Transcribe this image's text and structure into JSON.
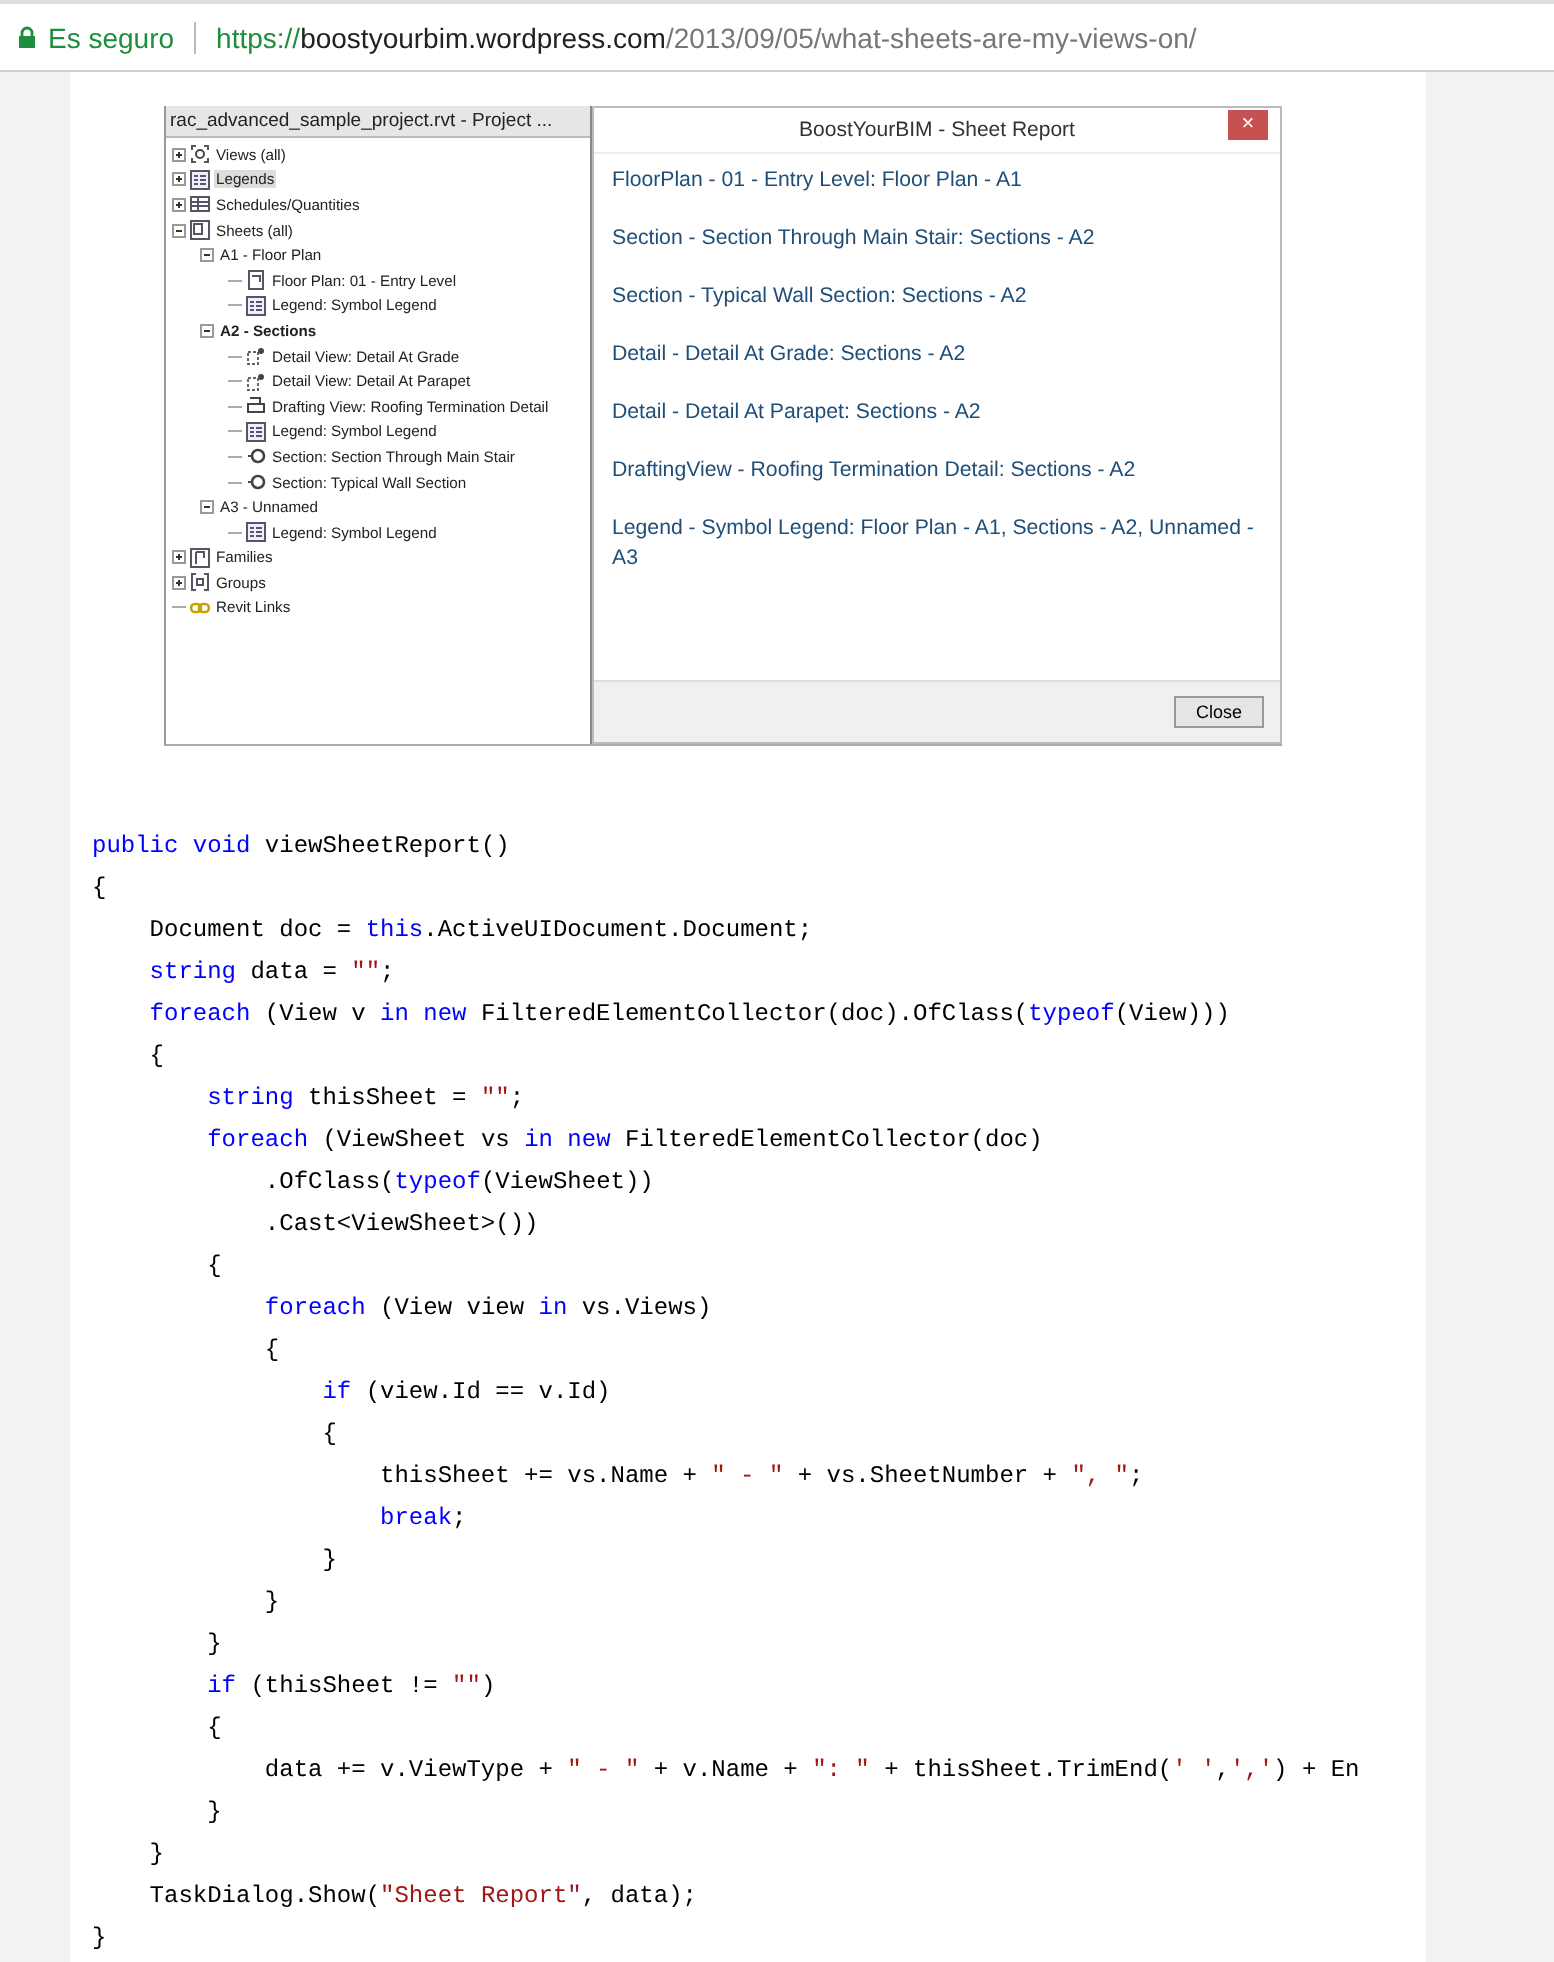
{
  "address_bar": {
    "security_label": "Es seguro",
    "url_scheme": "https://",
    "url_host": "boostyourbim.wordpress.com",
    "url_path": "/2013/09/05/what-sheets-are-my-views-on/"
  },
  "screenshot": {
    "project_browser": {
      "title": "rac_advanced_sample_project.rvt - Project ...",
      "tree": [
        {
          "label": "Views (all)",
          "kind": "views",
          "expanded": false,
          "selected": false,
          "bold": false
        },
        {
          "label": "Legends",
          "kind": "legend",
          "expanded": false,
          "selected": true,
          "bold": false
        },
        {
          "label": "Schedules/Quantities",
          "kind": "schedule",
          "expanded": false,
          "selected": false,
          "bold": false
        },
        {
          "label": "Sheets (all)",
          "kind": "sheet",
          "expanded": true,
          "selected": false,
          "bold": false,
          "children": [
            {
              "label": "A1 - Floor Plan",
              "expanded": true,
              "selected": false,
              "bold": false,
              "children": [
                {
                  "label": "Floor Plan: 01 - Entry Level",
                  "kind": "plan",
                  "selected": false,
                  "bold": false
                },
                {
                  "label": "Legend: Symbol Legend",
                  "kind": "legend",
                  "selected": false,
                  "bold": false
                }
              ]
            },
            {
              "label": "A2 - Sections",
              "expanded": true,
              "selected": false,
              "bold": true,
              "children": [
                {
                  "label": "Detail View: Detail At Grade",
                  "kind": "detail",
                  "selected": false,
                  "bold": false
                },
                {
                  "label": "Detail View: Detail At Parapet",
                  "kind": "detail",
                  "selected": false,
                  "bold": false
                },
                {
                  "label": "Drafting View: Roofing Termination Detail",
                  "kind": "drafting",
                  "selected": false,
                  "bold": false
                },
                {
                  "label": "Legend: Symbol Legend",
                  "kind": "legend",
                  "selected": false,
                  "bold": false
                },
                {
                  "label": "Section: Section Through Main Stair",
                  "kind": "section",
                  "selected": false,
                  "bold": false
                },
                {
                  "label": "Section: Typical Wall Section",
                  "kind": "section",
                  "selected": false,
                  "bold": false
                }
              ]
            },
            {
              "label": "A3 - Unnamed",
              "expanded": true,
              "selected": false,
              "bold": false,
              "children": [
                {
                  "label": "Legend: Symbol Legend",
                  "kind": "legend",
                  "selected": false,
                  "bold": false
                }
              ]
            }
          ]
        },
        {
          "label": "Families",
          "kind": "family",
          "expanded": false,
          "selected": false,
          "bold": false
        },
        {
          "label": "Groups",
          "kind": "group",
          "expanded": false,
          "selected": false,
          "bold": false
        },
        {
          "label": "Revit Links",
          "kind": "link",
          "selected": false,
          "bold": false
        }
      ]
    },
    "dialog": {
      "title": "BoostYourBIM - Sheet Report",
      "close_icon": "×",
      "lines": [
        "FloorPlan - 01 - Entry Level: Floor Plan - A1",
        "Section - Section Through Main Stair: Sections - A2",
        "Section - Typical Wall Section: Sections - A2",
        "Detail - Detail At Grade: Sections - A2",
        "Detail - Detail At Parapet: Sections - A2",
        "DraftingView - Roofing Termination Detail: Sections - A2",
        "Legend - Symbol Legend: Floor Plan - A1, Sections - A2, Unnamed - A3"
      ],
      "button": "Close"
    }
  },
  "code": [
    [
      {
        "kind": "keyword",
        "text": "public void"
      },
      {
        "kind": "plain",
        "text": " viewSheetReport()"
      }
    ],
    [
      {
        "kind": "plain",
        "text": "{"
      }
    ],
    [
      {
        "kind": "plain",
        "text": "    Document doc = "
      },
      {
        "kind": "keyword",
        "text": "this"
      },
      {
        "kind": "plain",
        "text": ".ActiveUIDocument.Document;"
      }
    ],
    [
      {
        "kind": "keyword",
        "text": "    string"
      },
      {
        "kind": "plain",
        "text": " data = "
      },
      {
        "kind": "string",
        "text": "\"\""
      },
      {
        "kind": "plain",
        "text": ";"
      }
    ],
    [
      {
        "kind": "keyword",
        "text": "    foreach"
      },
      {
        "kind": "plain",
        "text": " (View v "
      },
      {
        "kind": "keyword",
        "text": "in new"
      },
      {
        "kind": "plain",
        "text": " FilteredElementCollector(doc).OfClass("
      },
      {
        "kind": "keyword",
        "text": "typeof"
      },
      {
        "kind": "plain",
        "text": "(View)))"
      }
    ],
    [
      {
        "kind": "plain",
        "text": "    {"
      }
    ],
    [
      {
        "kind": "keyword",
        "text": "        string"
      },
      {
        "kind": "plain",
        "text": " thisSheet = "
      },
      {
        "kind": "string",
        "text": "\"\""
      },
      {
        "kind": "plain",
        "text": ";"
      }
    ],
    [
      {
        "kind": "keyword",
        "text": "        foreach"
      },
      {
        "kind": "plain",
        "text": " (ViewSheet vs "
      },
      {
        "kind": "keyword",
        "text": "in new"
      },
      {
        "kind": "plain",
        "text": " FilteredElementCollector(doc)"
      }
    ],
    [
      {
        "kind": "plain",
        "text": "            .OfClass("
      },
      {
        "kind": "keyword",
        "text": "typeof"
      },
      {
        "kind": "plain",
        "text": "(ViewSheet))"
      }
    ],
    [
      {
        "kind": "plain",
        "text": "            .Cast<ViewSheet>())"
      }
    ],
    [
      {
        "kind": "plain",
        "text": "        {"
      }
    ],
    [
      {
        "kind": "keyword",
        "text": "            foreach"
      },
      {
        "kind": "plain",
        "text": " (View view "
      },
      {
        "kind": "keyword",
        "text": "in"
      },
      {
        "kind": "plain",
        "text": " vs.Views)"
      }
    ],
    [
      {
        "kind": "plain",
        "text": "            {"
      }
    ],
    [
      {
        "kind": "keyword",
        "text": "                if"
      },
      {
        "kind": "plain",
        "text": " (view.Id == v.Id)"
      }
    ],
    [
      {
        "kind": "plain",
        "text": "                {"
      }
    ],
    [
      {
        "kind": "plain",
        "text": "                    thisSheet += vs.Name + "
      },
      {
        "kind": "string",
        "text": "\" - \""
      },
      {
        "kind": "plain",
        "text": " + vs.SheetNumber + "
      },
      {
        "kind": "string",
        "text": "\", \""
      },
      {
        "kind": "plain",
        "text": ";"
      }
    ],
    [
      {
        "kind": "keyword",
        "text": "                    break"
      },
      {
        "kind": "plain",
        "text": ";"
      }
    ],
    [
      {
        "kind": "plain",
        "text": "                }"
      }
    ],
    [
      {
        "kind": "plain",
        "text": "            }"
      }
    ],
    [
      {
        "kind": "plain",
        "text": "        }"
      }
    ],
    [
      {
        "kind": "keyword",
        "text": "        if"
      },
      {
        "kind": "plain",
        "text": " (thisSheet != "
      },
      {
        "kind": "string",
        "text": "\"\""
      },
      {
        "kind": "plain",
        "text": ")"
      }
    ],
    [
      {
        "kind": "plain",
        "text": "        {"
      }
    ],
    [
      {
        "kind": "plain",
        "text": "            data += v.ViewType + "
      },
      {
        "kind": "string",
        "text": "\" - \""
      },
      {
        "kind": "plain",
        "text": " + v.Name + "
      },
      {
        "kind": "string",
        "text": "\": \""
      },
      {
        "kind": "plain",
        "text": " + thisSheet.TrimEnd("
      },
      {
        "kind": "string",
        "text": "' '"
      },
      {
        "kind": "plain",
        "text": ","
      },
      {
        "kind": "string",
        "text": "','"
      },
      {
        "kind": "plain",
        "text": ") + En"
      }
    ],
    [
      {
        "kind": "plain",
        "text": "        }"
      }
    ],
    [
      {
        "kind": "plain",
        "text": "    }"
      }
    ],
    [
      {
        "kind": "plain",
        "text": "    TaskDialog.Show("
      },
      {
        "kind": "string",
        "text": "\"Sheet Report\""
      },
      {
        "kind": "plain",
        "text": ", data);"
      }
    ],
    [
      {
        "kind": "plain",
        "text": "}"
      }
    ]
  ]
}
